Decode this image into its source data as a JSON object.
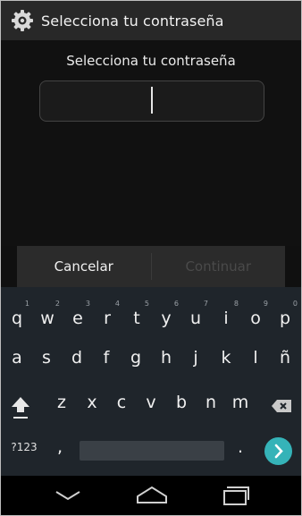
{
  "titlebar": {
    "title": "Selecciona tu contraseña",
    "icon": "gear-icon"
  },
  "dialog": {
    "prompt": "Selecciona tu contraseña",
    "password_value": ""
  },
  "buttons": {
    "cancel": "Cancelar",
    "continue": "Continuar"
  },
  "keyboard": {
    "row1": [
      {
        "key": "q",
        "hint": "1"
      },
      {
        "key": "w",
        "hint": "2"
      },
      {
        "key": "e",
        "hint": "3"
      },
      {
        "key": "r",
        "hint": "4"
      },
      {
        "key": "t",
        "hint": "5"
      },
      {
        "key": "y",
        "hint": "6"
      },
      {
        "key": "u",
        "hint": "7"
      },
      {
        "key": "i",
        "hint": "8"
      },
      {
        "key": "o",
        "hint": "9"
      },
      {
        "key": "p",
        "hint": "0"
      }
    ],
    "row2": [
      "a",
      "s",
      "d",
      "f",
      "g",
      "h",
      "j",
      "k",
      "l",
      "ñ"
    ],
    "row3": [
      "z",
      "x",
      "c",
      "v",
      "b",
      "n",
      "m"
    ],
    "symbols_label": "?123",
    "comma": ",",
    "period": ".",
    "accent_color": "#35b3b8"
  },
  "navbar": {
    "icons": [
      "back-icon",
      "home-icon",
      "recents-icon"
    ]
  }
}
